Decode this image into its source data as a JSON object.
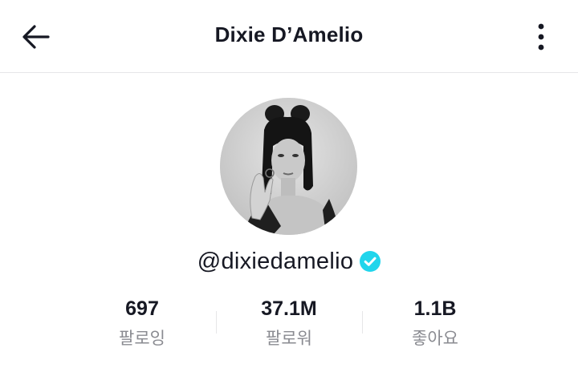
{
  "header": {
    "title": "Dixie D’Amelio",
    "back_icon": "arrow-left-icon",
    "more_icon": "vertical-dots-icon"
  },
  "profile": {
    "handle": "@dixiedamelio",
    "verified_icon": "verified-badge-icon",
    "verified_color": "#20d5ec",
    "avatar_description": "profile-photo"
  },
  "stats": [
    {
      "value": "697",
      "label": "팔로잉"
    },
    {
      "value": "37.1M",
      "label": "팔로워"
    },
    {
      "value": "1.1B",
      "label": "좋아요"
    }
  ],
  "colors": {
    "text_primary": "#161823",
    "text_secondary": "#8a8b91",
    "divider": "#e6e6e8"
  }
}
